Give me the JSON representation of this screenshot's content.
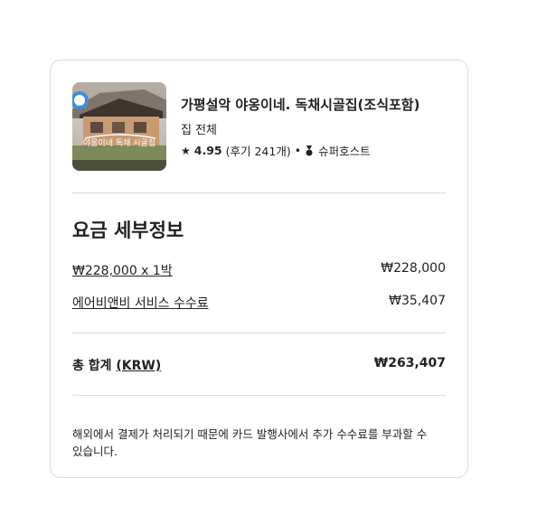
{
  "listing": {
    "thumbnail_caption": "야옹이네 독채 시골집",
    "title": "가평설악 야옹이네. 독채시골집(조식포함)",
    "type": "집 전체",
    "rating": "4.95",
    "reviews": "(후기 241개)",
    "separator": "•",
    "host_badge": "슈퍼호스트",
    "star_icon": "star-icon",
    "medal_icon": "medal-icon"
  },
  "price_details": {
    "heading": "요금 세부정보",
    "nightly_label": "₩228,000 x 1박",
    "nightly_amount": "₩228,000",
    "service_fee_label": "에어비앤비 서비스 수수료",
    "service_fee_amount": "₩35,407",
    "total_label": "총 합계",
    "total_currency": "(KRW)",
    "total_amount": "₩263,407"
  },
  "notice": "해외에서 결제가 처리되기 때문에 카드 발행사에서 추가 수수료를 부과할 수 있습니다."
}
